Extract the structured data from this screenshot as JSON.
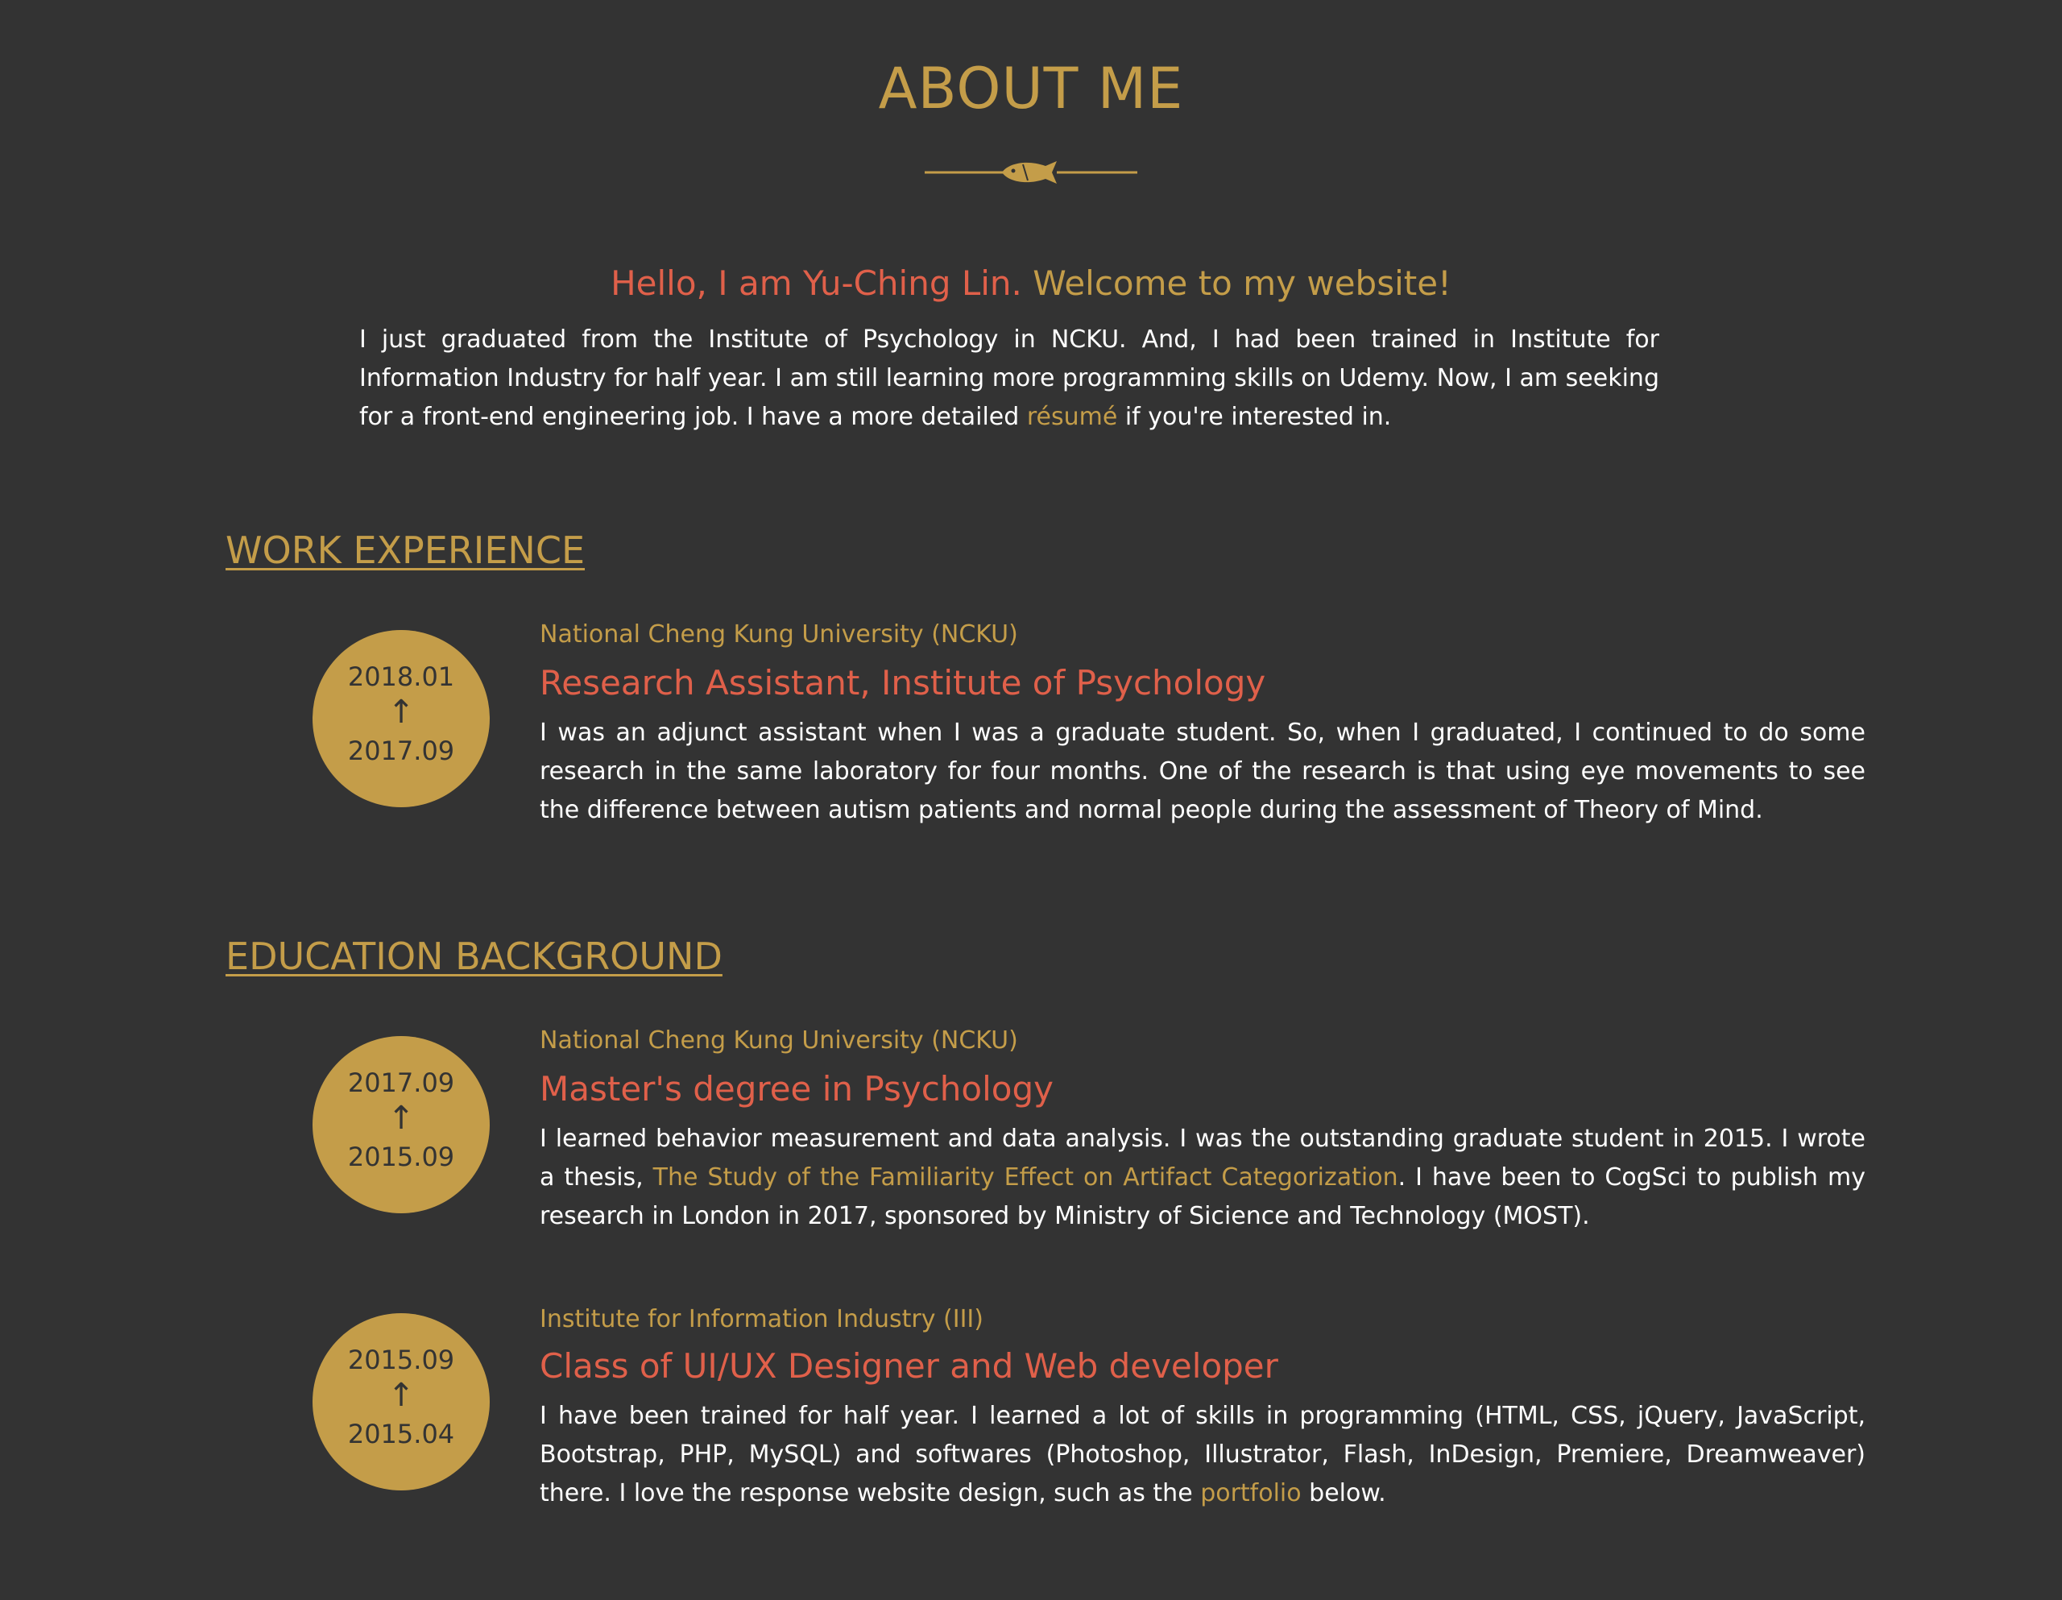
{
  "about": {
    "title": "ABOUT ME",
    "divider_icon": "fish-icon",
    "welcome_a": "Hello, I am Yu-Ching Lin.",
    "welcome_b": "Welcome to my website!",
    "intro_before": "I just graduated from the Institute of Psychology in NCKU. And, I had been trained in Institute for Information Industry for half year. I am still learning more programming skills on Udemy. Now, I am seeking for a front-end engineering job. I have a more detailed ",
    "intro_link": "résumé",
    "intro_after": " if you're interested in."
  },
  "work": {
    "title": "WORK EXPERIENCE",
    "entries": [
      {
        "date_end": "2018.01",
        "arrow": "↑",
        "date_start": "2017.09",
        "org": "National Cheng Kung University (NCKU)",
        "role": "Research Assistant, Institute of Psychology",
        "desc": "I was an adjunct assistant when I was a graduate student. So, when I graduated, I continued to do some research in the same laboratory for four months. One of the research is that using eye movements to see the difference between autism patients and normal people during the assessment of Theory of Mind."
      }
    ]
  },
  "education": {
    "title": "EDUCATION BACKGROUND",
    "entries": [
      {
        "date_end": "2017.09",
        "arrow": "↑",
        "date_start": "2015.09",
        "org": "National Cheng Kung University (NCKU)",
        "role": "Master's degree in Psychology",
        "desc_before": "I learned behavior measurement and data analysis. I was the outstanding graduate student in 2015. I wrote a thesis, ",
        "desc_link": "The Study of the Familiarity Effect on Artifact Categorization",
        "desc_after": ". I have been to CogSci to publish my research in London in 2017, sponsored by Ministry of Sicience and Technology (MOST)."
      },
      {
        "date_end": "2015.09",
        "arrow": "↑",
        "date_start": "2015.04",
        "org": "Institute for Information Industry (III)",
        "role": "Class of UI/UX Designer and Web developer",
        "desc_before": "I have been trained for half year. I learned a lot of skills in programming (HTML, CSS, jQuery, JavaScript, Bootstrap, PHP, MySQL) and softwares (Photoshop, Illustrator, Flash, InDesign, Premiere, Dreamweaver) there. I love the response website design, such as the ",
        "desc_link": "portfolio",
        "desc_after": " below."
      }
    ]
  },
  "colors": {
    "background": "#333333",
    "gold": "#c49d49",
    "coral": "#e0604a",
    "text": "#ffffff"
  }
}
